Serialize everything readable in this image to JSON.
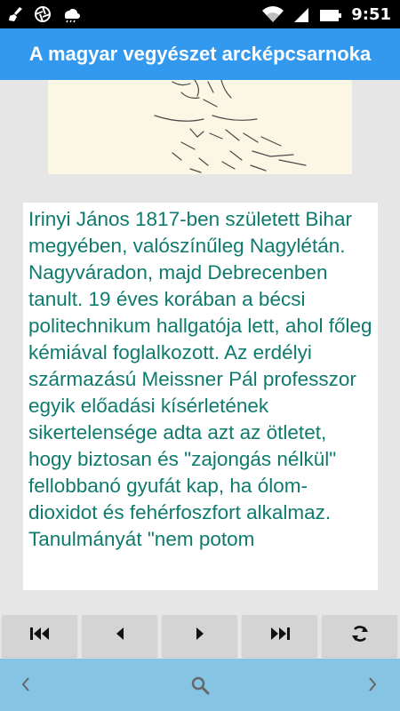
{
  "status_bar": {
    "time": "9:51",
    "icons": [
      "broom-icon",
      "aperture-icon",
      "weather-icon",
      "wifi-icon",
      "signal-icon",
      "battery-icon"
    ]
  },
  "header": {
    "title": "A magyar vegyészet arcképcsarnoka"
  },
  "content": {
    "bio_text": "Irinyi János 1817-ben született Bihar megyében, valószínűleg Nagylétán. Nagyváradon, majd Debrecenben tanult. 19 éves korában a bécsi politechnikum hallgatója lett, ahol főleg kémiával foglalkozott. Az erdélyi származású Meissner Pál professzor egyik előadási kísérletének sikertelensége adta azt az ötletet, hogy biztosan és \"zajongás nélkül\" fellobbanó gyufát kap, ha ólom-dioxidot és fehérfoszfort alkalmaz. Tanulmányát \"nem potom"
  },
  "controls": {
    "buttons": [
      "first-icon",
      "previous-icon",
      "next-icon",
      "last-icon",
      "refresh-icon"
    ]
  },
  "bottom_bar": {
    "icons": [
      "chevron-left-icon",
      "search-icon",
      "chevron-right-icon"
    ]
  },
  "colors": {
    "app_bar": "#3399ee",
    "bio_text": "#0f7a6e",
    "bottom_bar": "#86c4e4",
    "control_button": "#d4d4d4"
  }
}
